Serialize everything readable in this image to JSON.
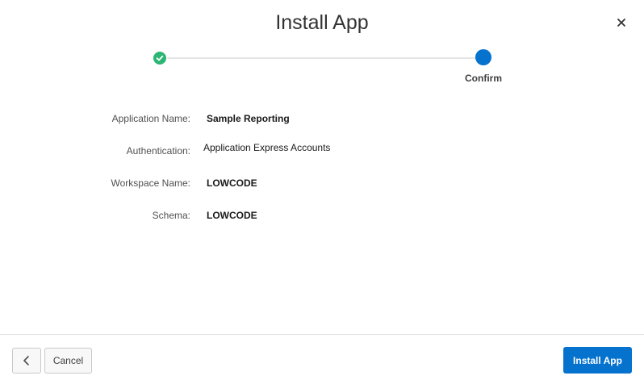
{
  "dialog": {
    "title": "Install App",
    "close_icon": "close-icon"
  },
  "wizard": {
    "steps": [
      {
        "status": "complete",
        "icon": "checkmark-icon",
        "label": ""
      },
      {
        "status": "current",
        "label": "Confirm"
      }
    ]
  },
  "details": [
    {
      "label": "Application Name:",
      "value": "Sample Reporting"
    },
    {
      "label": "Authentication:",
      "value": "Application Express Accounts"
    },
    {
      "label": "Workspace Name:",
      "value": "LOWCODE"
    },
    {
      "label": "Schema:",
      "value": "LOWCODE"
    }
  ],
  "footer": {
    "back_icon": "chevron-left-icon",
    "cancel_label": "Cancel",
    "install_label": "Install App"
  },
  "colors": {
    "accent": "#0572ce",
    "success": "#2bb673"
  }
}
